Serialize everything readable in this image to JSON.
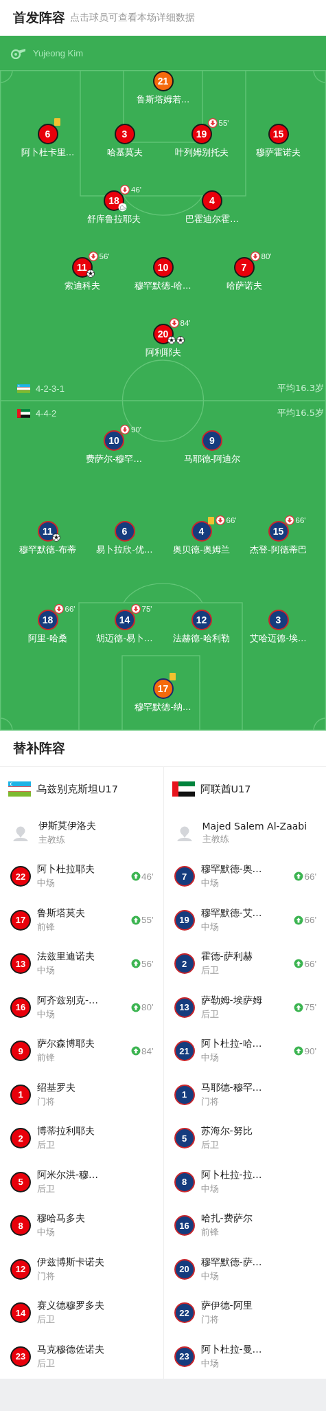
{
  "header": {
    "title": "首发阵容",
    "subtitle": "点击球员可查看本场详细数据"
  },
  "referee": {
    "name": "Yujeong Kim"
  },
  "lineups": [
    {
      "kind": "home",
      "flag": {
        "kind": "uzbekistan"
      },
      "formation": "4-2-3-1",
      "average_age": "平均16.3岁",
      "lines": [
        [
          {
            "number": "21",
            "name": "鲁斯塔姆若…",
            "kind": "keeper",
            "yellow_card": false
          }
        ],
        [
          {
            "number": "6",
            "name": "阿卜杜卡里…",
            "kind": "field",
            "yellow_card": true
          },
          {
            "number": "3",
            "name": "哈基莫夫",
            "kind": "field",
            "yellow_card": false
          },
          {
            "number": "19",
            "name": "叶列姆别托夫",
            "kind": "field",
            "yellow_card": false,
            "subbed_off": "55'"
          },
          {
            "number": "15",
            "name": "穆萨霍诺夫",
            "kind": "field",
            "yellow_card": false
          }
        ],
        [
          {
            "number": "18",
            "name": "舒库鲁拉耶夫",
            "kind": "field",
            "yellow_card": false,
            "subbed_off": "46'",
            "events": [
              {
                "kind": "assist"
              }
            ]
          },
          {
            "number": "4",
            "name": "巴霍迪尔霍…",
            "kind": "field",
            "yellow_card": false
          }
        ],
        [
          {
            "number": "11",
            "name": "索迪科夫",
            "kind": "field",
            "yellow_card": false,
            "subbed_off": "56'",
            "events": [
              {
                "kind": "goal"
              }
            ]
          },
          {
            "number": "10",
            "name": "穆罕默德-哈…",
            "kind": "field",
            "yellow_card": false
          },
          {
            "number": "7",
            "name": "哈萨诺夫",
            "kind": "field",
            "yellow_card": false,
            "subbed_off": "80'"
          }
        ],
        [
          {
            "number": "20",
            "name": "阿利耶夫",
            "kind": "field",
            "yellow_card": false,
            "subbed_off": "84'",
            "events": [
              {
                "kind": "goal"
              },
              {
                "kind": "goal"
              }
            ]
          }
        ]
      ]
    },
    {
      "kind": "away",
      "flag": {
        "kind": "uae"
      },
      "formation": "4-4-2",
      "average_age": "平均16.5岁",
      "lines": [
        [
          {
            "number": "10",
            "name": "费萨尔-穆罕…",
            "kind": "field",
            "yellow_card": false,
            "subbed_off": "90'"
          },
          {
            "number": "9",
            "name": "马耶德-阿迪尔",
            "kind": "field",
            "yellow_card": false
          }
        ],
        [
          {
            "number": "11",
            "name": "穆罕默德-布蒂",
            "kind": "field",
            "yellow_card": false,
            "events": [
              {
                "kind": "goal"
              }
            ]
          },
          {
            "number": "6",
            "name": "易卜拉欣-优…",
            "kind": "field",
            "yellow_card": false
          },
          {
            "number": "4",
            "name": "奥贝德-奥姆兰",
            "kind": "field",
            "yellow_card": true,
            "subbed_off": "66'"
          },
          {
            "number": "15",
            "name": "杰登-阿德蒂巴",
            "kind": "field",
            "yellow_card": false,
            "subbed_off": "66'"
          }
        ],
        [
          {
            "number": "18",
            "name": "阿里-哈桑",
            "kind": "field",
            "yellow_card": false,
            "subbed_off": "66'"
          },
          {
            "number": "14",
            "name": "胡迈德-易卜…",
            "kind": "field",
            "yellow_card": false,
            "subbed_off": "75'"
          },
          {
            "number": "12",
            "name": "法赫德-哈利勒",
            "kind": "field",
            "yellow_card": false
          },
          {
            "number": "3",
            "name": "艾哈迈德-埃…",
            "kind": "field",
            "yellow_card": false
          }
        ],
        [
          {
            "number": "17",
            "name": "穆罕默德-纳…",
            "kind": "keeper",
            "yellow_card": true
          }
        ]
      ]
    }
  ],
  "substitutes": {
    "title": "替补阵容",
    "teams": [
      {
        "kind": "home",
        "flag": {
          "kind": "uzbekistan"
        },
        "name": "乌兹别克斯坦U17",
        "coach": {
          "name": "伊斯莫伊洛夫",
          "role": "主教练"
        },
        "players": [
          {
            "number": "22",
            "name": "阿卜杜拉耶夫",
            "position": "中场",
            "subbed_on": "46'"
          },
          {
            "number": "17",
            "name": "鲁斯塔莫夫",
            "position": "前锋",
            "subbed_on": "55'"
          },
          {
            "number": "13",
            "name": "法兹里迪诺夫",
            "position": "中场",
            "subbed_on": "56'"
          },
          {
            "number": "16",
            "name": "阿齐兹别克-…",
            "position": "中场",
            "subbed_on": "80'"
          },
          {
            "number": "9",
            "name": "萨尔森博耶夫",
            "position": "前锋",
            "subbed_on": "84'"
          },
          {
            "number": "1",
            "name": "绍基罗夫",
            "position": "门将"
          },
          {
            "number": "2",
            "name": "博蒂拉利耶夫",
            "position": "后卫"
          },
          {
            "number": "5",
            "name": "阿米尔洪-穆…",
            "position": "后卫"
          },
          {
            "number": "8",
            "name": "穆哈马多夫",
            "position": "中场"
          },
          {
            "number": "12",
            "name": "伊兹博斯卡诺夫",
            "position": "门将"
          },
          {
            "number": "14",
            "name": "赛义德穆罗多夫",
            "position": "后卫"
          },
          {
            "number": "23",
            "name": "马克穆德佐诺夫",
            "position": "后卫"
          }
        ]
      },
      {
        "kind": "away",
        "flag": {
          "kind": "uae"
        },
        "name": "阿联酋U17",
        "coach": {
          "name": "Majed Salem Al-Zaabi",
          "role": "主教练"
        },
        "players": [
          {
            "number": "7",
            "name": "穆罕默德-奥…",
            "position": "中场",
            "subbed_on": "66'"
          },
          {
            "number": "19",
            "name": "穆罕默德-艾…",
            "position": "中场",
            "subbed_on": "66'"
          },
          {
            "number": "2",
            "name": "霍德-萨利赫",
            "position": "后卫",
            "subbed_on": "66'"
          },
          {
            "number": "13",
            "name": "萨勒姆-埃萨姆",
            "position": "后卫",
            "subbed_on": "75'"
          },
          {
            "number": "21",
            "name": "阿卜杜拉-哈…",
            "position": "中场",
            "subbed_on": "90'"
          },
          {
            "number": "1",
            "name": "马耶德-穆罕…",
            "position": "门将"
          },
          {
            "number": "5",
            "name": "苏海尔-努比",
            "position": "后卫"
          },
          {
            "number": "8",
            "name": "阿卜杜拉-拉…",
            "position": "中场"
          },
          {
            "number": "16",
            "name": "哈扎-费萨尔",
            "position": "前锋"
          },
          {
            "number": "20",
            "name": "穆罕默德-萨…",
            "position": "中场"
          },
          {
            "number": "22",
            "name": "萨伊德-阿里",
            "position": "门将"
          },
          {
            "number": "23",
            "name": "阿卜杜拉-曼…",
            "position": "中场"
          }
        ]
      }
    ]
  }
}
